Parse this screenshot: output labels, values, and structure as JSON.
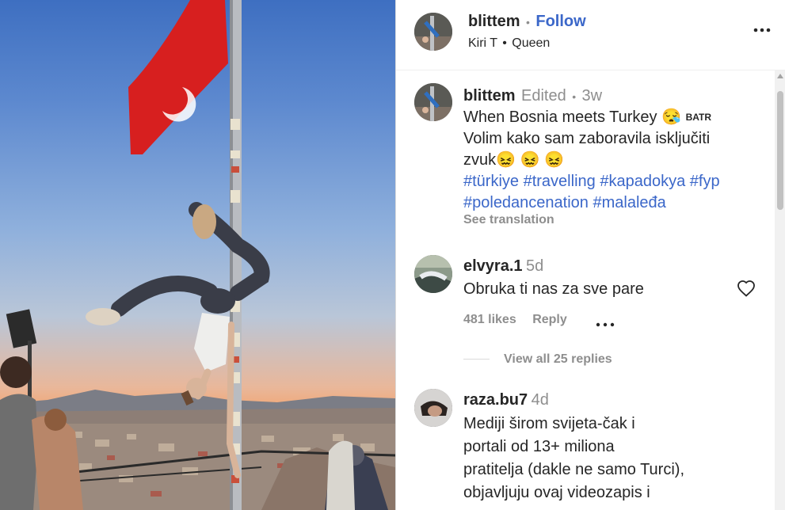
{
  "header": {
    "username": "blittem",
    "separator": "•",
    "follow_label": "Follow",
    "song_artist": "Kiri T",
    "song_sep": "•",
    "song_title": "Queen"
  },
  "caption": {
    "username": "blittem",
    "edited": "Edited",
    "sep": "•",
    "time": "3w",
    "line1": "When Bosnia meets Turkey 😪",
    "line1_badge": "BATR",
    "line2": "Volim kako sam zaboravila isključiti",
    "line3": "zvuk😖 😖 😖",
    "hashtags_line1": [
      "#türkiye",
      "#travelling",
      "#kapadokya",
      "#fyp"
    ],
    "hashtags_line2": [
      "#poledancenation",
      "#malaleđa"
    ],
    "see_translation": "See translation"
  },
  "comments": [
    {
      "username": "elvyra.1",
      "time": "5d",
      "text": "Obruka ti nas za sve pare",
      "likes": "481 likes",
      "reply_label": "Reply",
      "view_replies": "View all 25 replies"
    },
    {
      "username": "raza.bu7",
      "time": "4d",
      "lines": [
        "Mediji širom svijeta-čak i",
        "portali od 13+ miliona",
        "pratitelja (dakle ne samo Turci),",
        "objavljuju ovaj videozapis i"
      ]
    }
  ],
  "colors": {
    "link": "#3b67c9",
    "muted": "#8e8e8e",
    "text": "#262626"
  },
  "icons": [
    "more-options-icon",
    "heart-icon",
    "comment-options-icon"
  ]
}
